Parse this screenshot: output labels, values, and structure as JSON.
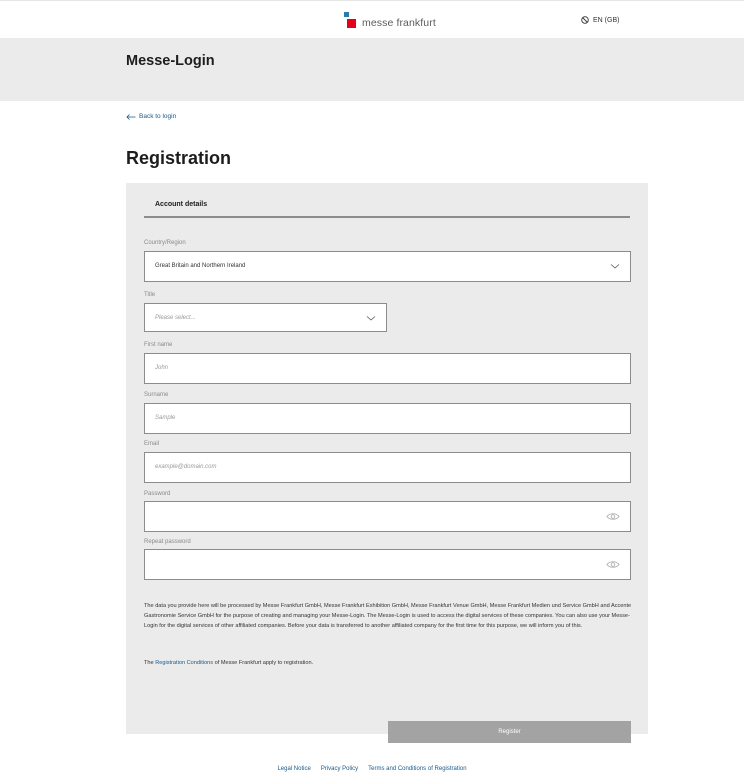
{
  "header": {
    "logo_text": "messe frankfurt",
    "language": "EN (GB)"
  },
  "band": {
    "title": "Messe-Login"
  },
  "back_link": "Back to login",
  "page_title": "Registration",
  "form": {
    "section": "Account details",
    "country_label": "Country/Region",
    "country_value": "Great Britain and Northern Ireland",
    "title_label": "Title",
    "title_placeholder": "Please select...",
    "firstname_label": "First name",
    "firstname_placeholder": "John",
    "surname_label": "Surname",
    "surname_placeholder": "Sample",
    "email_label": "Email",
    "email_placeholder": "example@domain.com",
    "password_label": "Password",
    "repeat_password_label": "Repeat password",
    "notice": "The data you provide here will be processed by Messe Frankfurt GmbH, Messe Frankfurt Exhibition GmbH, Messe Frankfurt Venue GmbH, Messe Frankfurt Medien und Service GmbH and Accente Gastronomie Service GmbH for the purpose of creating and managing your Messe-Login. The Messe-Login is used to access the digital services of these companies. You can also use your Messe-Login for the digital services of other affiliated companies. Before your data is transferred to another affiliated company for the first time for this purpose, we will inform you of this.",
    "conditions_prefix": "The ",
    "conditions_link": "Registration Conditions",
    "conditions_suffix": " of Messe Frankfurt apply to registration.",
    "register_button": "Register"
  },
  "footer": {
    "legal": "Legal Notice",
    "privacy": "Privacy Policy",
    "terms": "Terms and Conditions of Registration"
  },
  "colors": {
    "panel_bg": "#ebebeb",
    "link": "#1a5a8c",
    "button_disabled": "#a3a3a3",
    "logo_red": "#e3001b",
    "logo_blue": "#2a7ab0"
  },
  "icons": [
    "logo-mark-icon",
    "globe-icon",
    "arrow-left-icon",
    "chevron-down-icon",
    "eye-icon"
  ]
}
